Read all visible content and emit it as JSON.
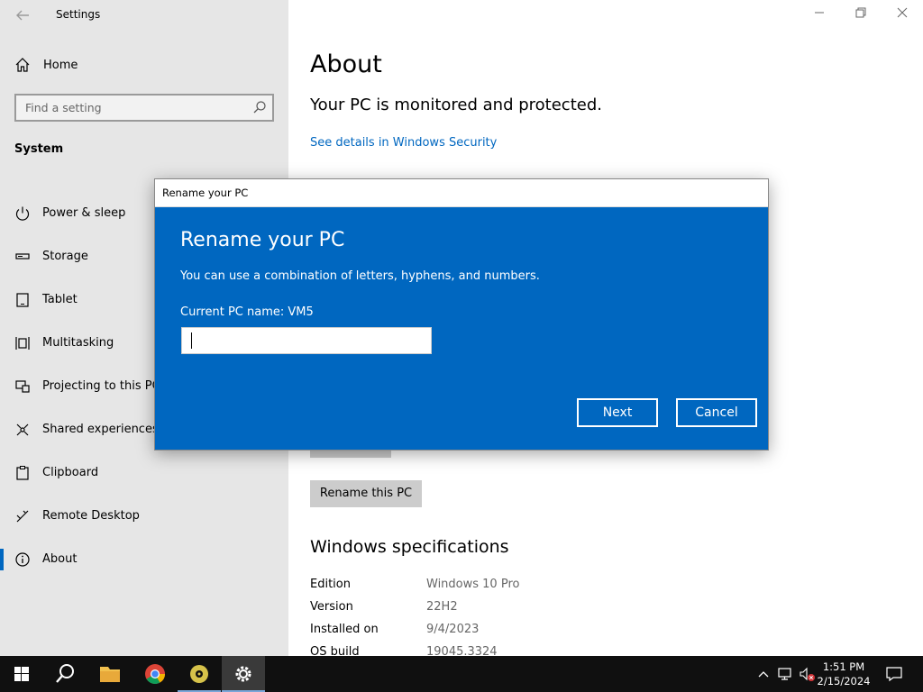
{
  "app": {
    "title": "Settings"
  },
  "sidebar": {
    "home_label": "Home",
    "search_placeholder": "Find a setting",
    "section_title": "System",
    "items": [
      {
        "label": "Power & sleep",
        "icon": "power-icon"
      },
      {
        "label": "Storage",
        "icon": "storage-icon"
      },
      {
        "label": "Tablet",
        "icon": "tablet-icon"
      },
      {
        "label": "Multitasking",
        "icon": "multitasking-icon"
      },
      {
        "label": "Projecting to this PC",
        "icon": "projecting-icon"
      },
      {
        "label": "Shared experiences",
        "icon": "shared-experiences-icon"
      },
      {
        "label": "Clipboard",
        "icon": "clipboard-icon"
      },
      {
        "label": "Remote Desktop",
        "icon": "remote-desktop-icon"
      },
      {
        "label": "About",
        "icon": "info-icon",
        "active": true
      }
    ]
  },
  "main": {
    "title": "About",
    "protection_text": "Your PC is monitored and protected.",
    "security_link": "See details in Windows Security",
    "rename_button": "Rename this PC",
    "specs_title": "Windows specifications",
    "specs": [
      {
        "key": "Edition",
        "value": "Windows 10 Pro"
      },
      {
        "key": "Version",
        "value": "22H2"
      },
      {
        "key": "Installed on",
        "value": "9/4/2023"
      },
      {
        "key": "OS build",
        "value": "19045.3324"
      }
    ]
  },
  "dialog": {
    "window_title": "Rename your PC",
    "heading": "Rename your PC",
    "description": "You can use a combination of letters, hyphens, and numbers.",
    "current_name": "Current PC name: VM5",
    "input_value": "",
    "next_label": "Next",
    "cancel_label": "Cancel"
  },
  "taskbar": {
    "time": "1:51 PM",
    "date": "2/15/2024"
  },
  "colors": {
    "accent": "#0067c0",
    "sidebar_bg": "#e6e6e6",
    "taskbar_bg": "#101010"
  }
}
